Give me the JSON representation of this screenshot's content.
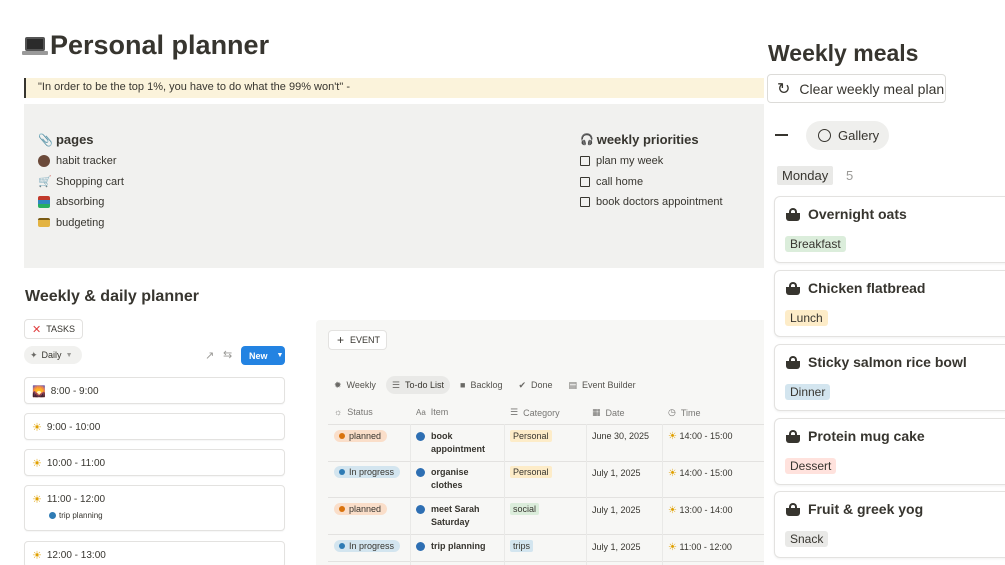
{
  "page": {
    "title": "Personal planner",
    "title_icon": "laptop-icon",
    "quote": "\"In order to be the top 1%, you have to do what the 99% won't\" -"
  },
  "pages_section": {
    "heading": "pages",
    "heading_icon": "paperclip-icon",
    "items": [
      {
        "label": "habit tracker",
        "icon": "woman-technologist-icon"
      },
      {
        "label": "Shopping cart",
        "icon": "shopping-cart-icon"
      },
      {
        "label": "absorbing",
        "icon": "books-icon"
      },
      {
        "label": "budgeting",
        "icon": "credit-card-icon"
      }
    ]
  },
  "priorities": {
    "heading": "weekly priorities",
    "heading_icon": "headphones-icon",
    "items": [
      {
        "label": "plan my week",
        "checked": false
      },
      {
        "label": "call home",
        "checked": false
      },
      {
        "label": "book doctors appointment",
        "checked": false
      }
    ]
  },
  "planner": {
    "title": "Weekly & daily planner",
    "tasks_label": "TASKS",
    "view_label": "Daily",
    "new_label": "New",
    "slots": [
      {
        "time": "8:00 - 9:00",
        "icon": "sunrise-icon",
        "sub": ""
      },
      {
        "time": "9:00 - 10:00",
        "icon": "sun-icon",
        "sub": ""
      },
      {
        "time": "10:00 - 11:00",
        "icon": "sun-icon",
        "sub": ""
      },
      {
        "time": "11:00 - 12:00",
        "icon": "sun-icon",
        "sub": "trip planning"
      },
      {
        "time": "12:00 - 13:00",
        "icon": "sun-icon",
        "sub": ""
      }
    ]
  },
  "table": {
    "event_label": "EVENT",
    "views": [
      "Weekly",
      "To-do List",
      "Backlog",
      "Done",
      "Event Builder"
    ],
    "active_view": "To-do List",
    "columns": [
      "Status",
      "Item",
      "Category",
      "Date",
      "Time"
    ],
    "rows": [
      {
        "status": "planned",
        "item": "book appointment",
        "category": "Personal",
        "date": "June 30, 2025",
        "time": "14:00 - 15:00"
      },
      {
        "status": "In progress",
        "item": "organise clothes",
        "category": "Personal",
        "date": "July 1, 2025",
        "time": "14:00 - 15:00"
      },
      {
        "status": "planned",
        "item": "meet Sarah Saturday",
        "category": "social",
        "date": "July 1, 2025",
        "time": "13:00 - 14:00"
      },
      {
        "status": "In progress",
        "item": "trip planning",
        "category": "trips",
        "date": "July 1, 2025",
        "time": "11:00 - 12:00"
      }
    ],
    "colors": {
      "planned_bg": "#fadec9",
      "planned_dot": "#d9730d",
      "progress_bg": "#d3e5ef",
      "progress_dot": "#2e7bb4",
      "personal_bg": "#fdecc8",
      "social_bg": "#dbeddb",
      "trips_bg": "#d3e5ef"
    }
  },
  "meals": {
    "title": "Weekly meals",
    "clear_label": "Clear weekly meal plan",
    "view_label": "Gallery",
    "group_label": "Monday",
    "group_count": "5",
    "cards": [
      {
        "name": "Overnight oats",
        "tag": "Breakfast",
        "tag_bg": "#dbeddb"
      },
      {
        "name": "Chicken flatbread",
        "tag": "Lunch",
        "tag_bg": "#fdecc8"
      },
      {
        "name": "Sticky salmon rice bowl",
        "tag": "Dinner",
        "tag_bg": "#d3e5ef"
      },
      {
        "name": "Protein mug cake",
        "tag": "Dessert",
        "tag_bg": "#ffe2dd"
      },
      {
        "name": "Fruit & greek yog",
        "tag": "Snack",
        "tag_bg": "#e9e9e7"
      }
    ]
  }
}
